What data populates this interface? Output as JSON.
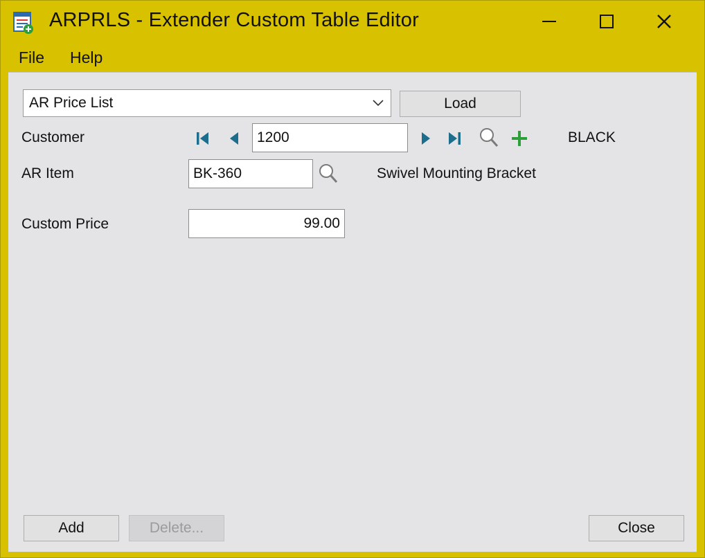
{
  "window": {
    "title": "ARPRLS - Extender Custom Table Editor",
    "titlebar_color": "#d8c200"
  },
  "menu": {
    "file": "File",
    "help": "Help"
  },
  "table_select": {
    "value": "AR Price List",
    "load_label": "Load"
  },
  "customer": {
    "label": "Customer",
    "value": "1200",
    "name": "BLACK"
  },
  "ar_item": {
    "label": "AR Item",
    "value": "BK-360",
    "description": "Swivel Mounting Bracket"
  },
  "custom_price": {
    "label": "Custom Price",
    "value": "99.00"
  },
  "buttons": {
    "add": "Add",
    "delete": "Delete...",
    "close": "Close"
  },
  "icons": {
    "first": "first-record-icon",
    "prev": "previous-record-icon",
    "next": "next-record-icon",
    "last": "last-record-icon",
    "lookup": "magnifier-icon",
    "add": "plus-icon"
  },
  "colors": {
    "nav_teal": "#1c6e8c",
    "plus_green": "#2e9e3a"
  }
}
